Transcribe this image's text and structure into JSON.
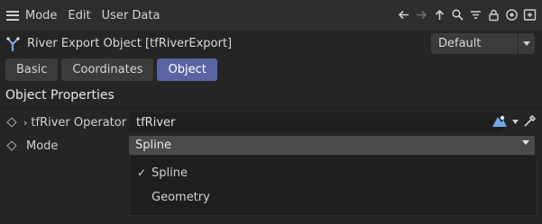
{
  "menubar": {
    "items": [
      "Mode",
      "Edit",
      "User Data"
    ],
    "icons": [
      "back-arrow-icon",
      "forward-arrow-icon",
      "up-arrow-icon",
      "search-icon",
      "filter-icon",
      "lock-icon",
      "target-icon",
      "new-panel-icon"
    ]
  },
  "header": {
    "title": "River Export Object [tfRiverExport]",
    "preset": "Default"
  },
  "tabs": [
    {
      "label": "Basic",
      "active": false
    },
    {
      "label": "Coordinates",
      "active": false
    },
    {
      "label": "Object",
      "active": true
    }
  ],
  "section": {
    "title": "Object Properties"
  },
  "properties": {
    "operator": {
      "label": "tfRiver Operator",
      "value": "tfRiver"
    },
    "mode": {
      "label": "Mode",
      "value": "Spline"
    }
  },
  "dropdown": {
    "options": [
      {
        "label": "Spline",
        "checked": true
      },
      {
        "label": "Geometry",
        "checked": false
      }
    ]
  },
  "colors": {
    "accent": "#5a64a5",
    "background": "#252525"
  }
}
